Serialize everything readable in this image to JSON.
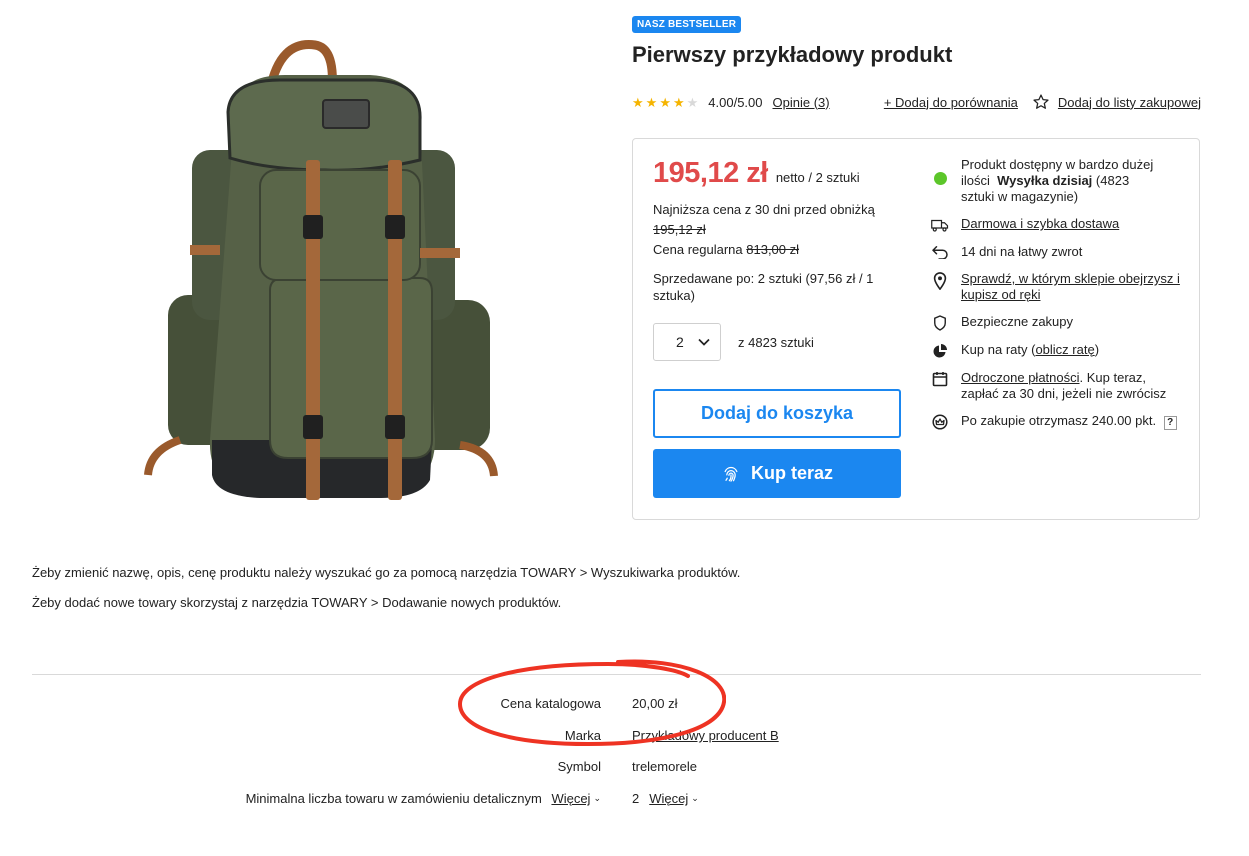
{
  "product": {
    "badge": "NASZ BESTSELLER",
    "title": "Pierwszy przykładowy produkt",
    "rating": {
      "stars_filled": 4,
      "stars_total": 5,
      "score_text": "4.00/5.00",
      "reviews_link": "Opinie (3)"
    },
    "compare_link": "+ Dodaj do porównania",
    "wishlist_link": "Dodaj do listy zakupowej"
  },
  "price_box": {
    "price": "195,12 zł",
    "price_unit": "netto / 2 sztuki",
    "lowest_label": "Najniższa cena z 30 dni przed obniżką",
    "lowest_value": "195,12 zł",
    "regular_label": "Cena regularna",
    "regular_value": "813,00 zł",
    "sold_by_line1": "Sprzedawane po: 2 sztuki (97,56 zł / 1",
    "sold_by_line2": "sztuka)",
    "quantity_value": "2",
    "quantity_available": "z 4823 sztuki",
    "add_to_cart": "Dodaj do koszyka",
    "buy_now": "Kup teraz"
  },
  "features": {
    "availability_line1": "Produkt dostępny w bardzo dużej",
    "availability_line2a": "ilości",
    "availability_bold": "Wysyłka dzisiaj",
    "availability_line2b": "(4823",
    "availability_line3": "sztuki w magazynie)",
    "delivery_link": "Darmowa i szybka dostawa",
    "return_text": "14 dni na łatwy zwrot",
    "store_link_line1": "Sprawdź, w którym sklepie obejrzysz i",
    "store_link_line2": "kupisz od ręki",
    "secure_text": "Bezpieczne zakupy",
    "installment_text": "Kup na raty (",
    "installment_link": "oblicz ratę",
    "installment_close": ")",
    "deferred_link": "Odroczone płatności",
    "deferred_text1": ". Kup teraz,",
    "deferred_text2": "zapłać za 30 dni, jeżeli nie zwrócisz",
    "points_text": "Po zakupie otrzymasz 240.00 pkt.",
    "points_help": "?"
  },
  "description": {
    "line1": "Żeby zmienić nazwę, opis, cenę produktu należy wyszukać go za pomocą narzędzia TOWARY > Wyszukiwarka produktów.",
    "line2": "Żeby dodać nowe towary skorzystaj z narzędzia TOWARY > Dodawanie nowych produktów."
  },
  "specs": {
    "catalog_label": "Cena katalogowa",
    "catalog_value": "20,00 zł",
    "brand_label": "Marka",
    "brand_value": "Przykładowy producent B",
    "symbol_label": "Symbol",
    "symbol_value": "trelemorele",
    "min_label": "Minimalna liczba towaru w zamówieniu detalicznym",
    "min_more": "Więcej",
    "min_value": "2",
    "min_value_more": "Więcej"
  },
  "colors": {
    "accent": "#1b87f0",
    "price": "#e04a4a",
    "star": "#f5b400",
    "available": "#5cc62a",
    "annotation": "#ee3323"
  }
}
